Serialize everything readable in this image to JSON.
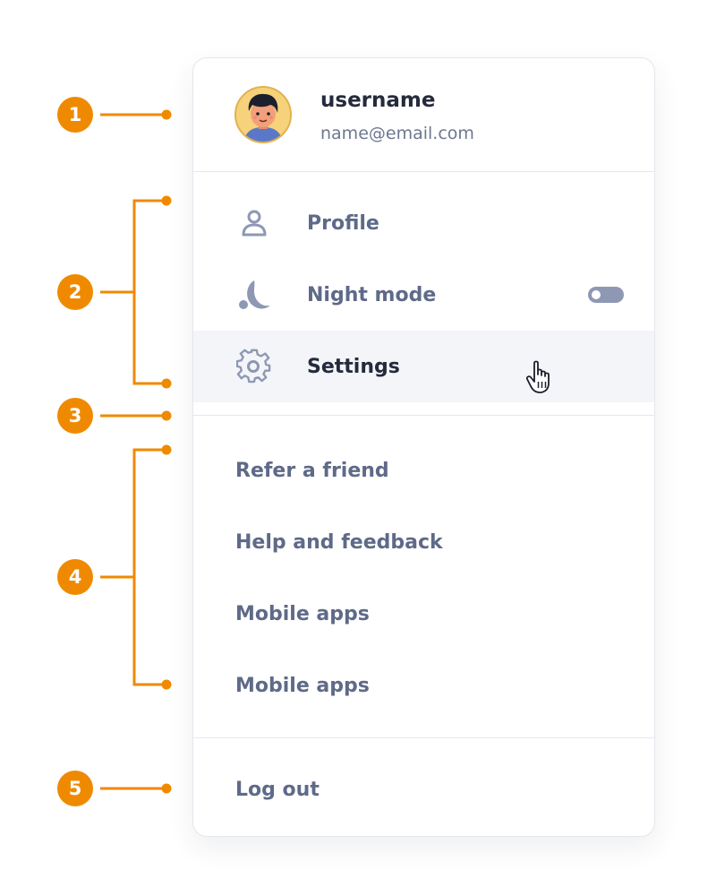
{
  "annotations": {
    "badges": [
      "1",
      "2",
      "3",
      "4",
      "5"
    ],
    "color": "#ef8a00"
  },
  "user": {
    "username": "username",
    "email": "name@email.com"
  },
  "menu_primary": [
    {
      "label": "Profile",
      "icon": "person-icon"
    },
    {
      "label": "Night mode",
      "icon": "moon-icon",
      "toggle": "off"
    },
    {
      "label": "Settings",
      "icon": "gear-icon",
      "state": "hover"
    }
  ],
  "menu_secondary": [
    {
      "label": "Refer a friend"
    },
    {
      "label": "Help and feedback"
    },
    {
      "label": "Mobile apps"
    },
    {
      "label": "Mobile apps"
    }
  ],
  "logout": {
    "label": "Log out"
  },
  "colors": {
    "text_primary": "#252b3c",
    "text_secondary": "#5e6a88",
    "hover_bg": "#f3f5f9",
    "icon": "#8e98b3"
  }
}
